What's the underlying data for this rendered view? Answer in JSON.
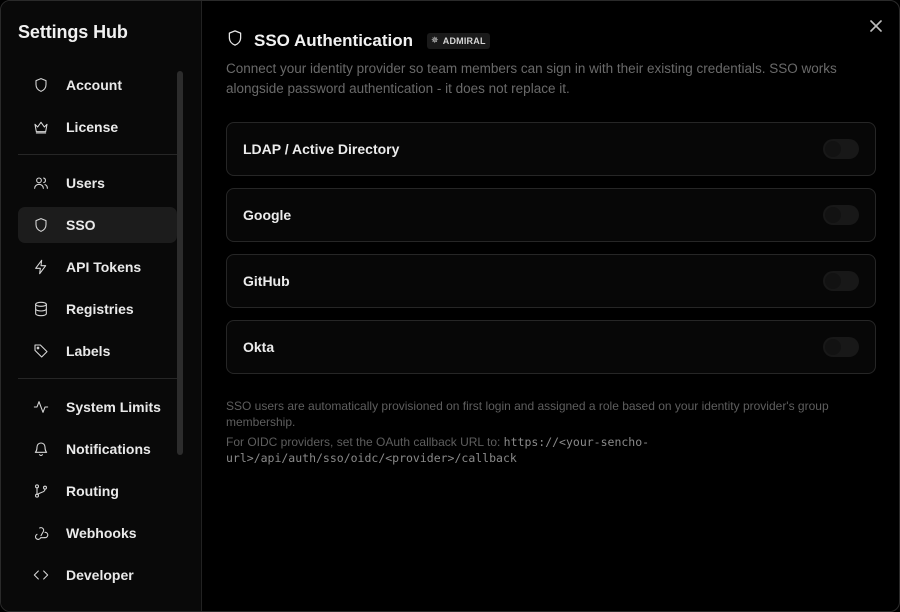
{
  "sidebar": {
    "title": "Settings Hub",
    "groups": [
      [
        {
          "label": "Account",
          "icon": "shield-icon"
        },
        {
          "label": "License",
          "icon": "crown-icon"
        }
      ],
      [
        {
          "label": "Users",
          "icon": "users-icon"
        },
        {
          "label": "SSO",
          "icon": "shield-icon",
          "active": true
        },
        {
          "label": "API Tokens",
          "icon": "lightning-icon"
        },
        {
          "label": "Registries",
          "icon": "database-icon"
        },
        {
          "label": "Labels",
          "icon": "tag-icon"
        }
      ],
      [
        {
          "label": "System Limits",
          "icon": "activity-icon"
        },
        {
          "label": "Notifications",
          "icon": "bell-icon"
        },
        {
          "label": "Routing",
          "icon": "git-branch-icon"
        },
        {
          "label": "Webhooks",
          "icon": "webhook-icon"
        },
        {
          "label": "Developer",
          "icon": "code-icon"
        }
      ]
    ]
  },
  "main": {
    "title": "SSO Authentication",
    "badge": "ADMIRAL",
    "description": "Connect your identity provider so team members can sign in with their existing credentials. SSO works alongside password authentication - it does not replace it.",
    "providers": [
      {
        "name": "LDAP / Active Directory",
        "enabled": false
      },
      {
        "name": "Google",
        "enabled": false
      },
      {
        "name": "GitHub",
        "enabled": false
      },
      {
        "name": "Okta",
        "enabled": false
      }
    ],
    "footnote_1": "SSO users are automatically provisioned on first login and assigned a role based on your identity provider's group membership.",
    "footnote_2_prefix": "For OIDC providers, set the OAuth callback URL to:",
    "callback_url": "https://<your-sencho-url>/api/auth/sso/oidc/<provider>/callback"
  },
  "colors": {
    "background": "#000000",
    "sidebar_bg": "#090909",
    "active_item_bg": "#1c1c1c",
    "border": "#262626",
    "muted_text": "#6a6a6a"
  }
}
